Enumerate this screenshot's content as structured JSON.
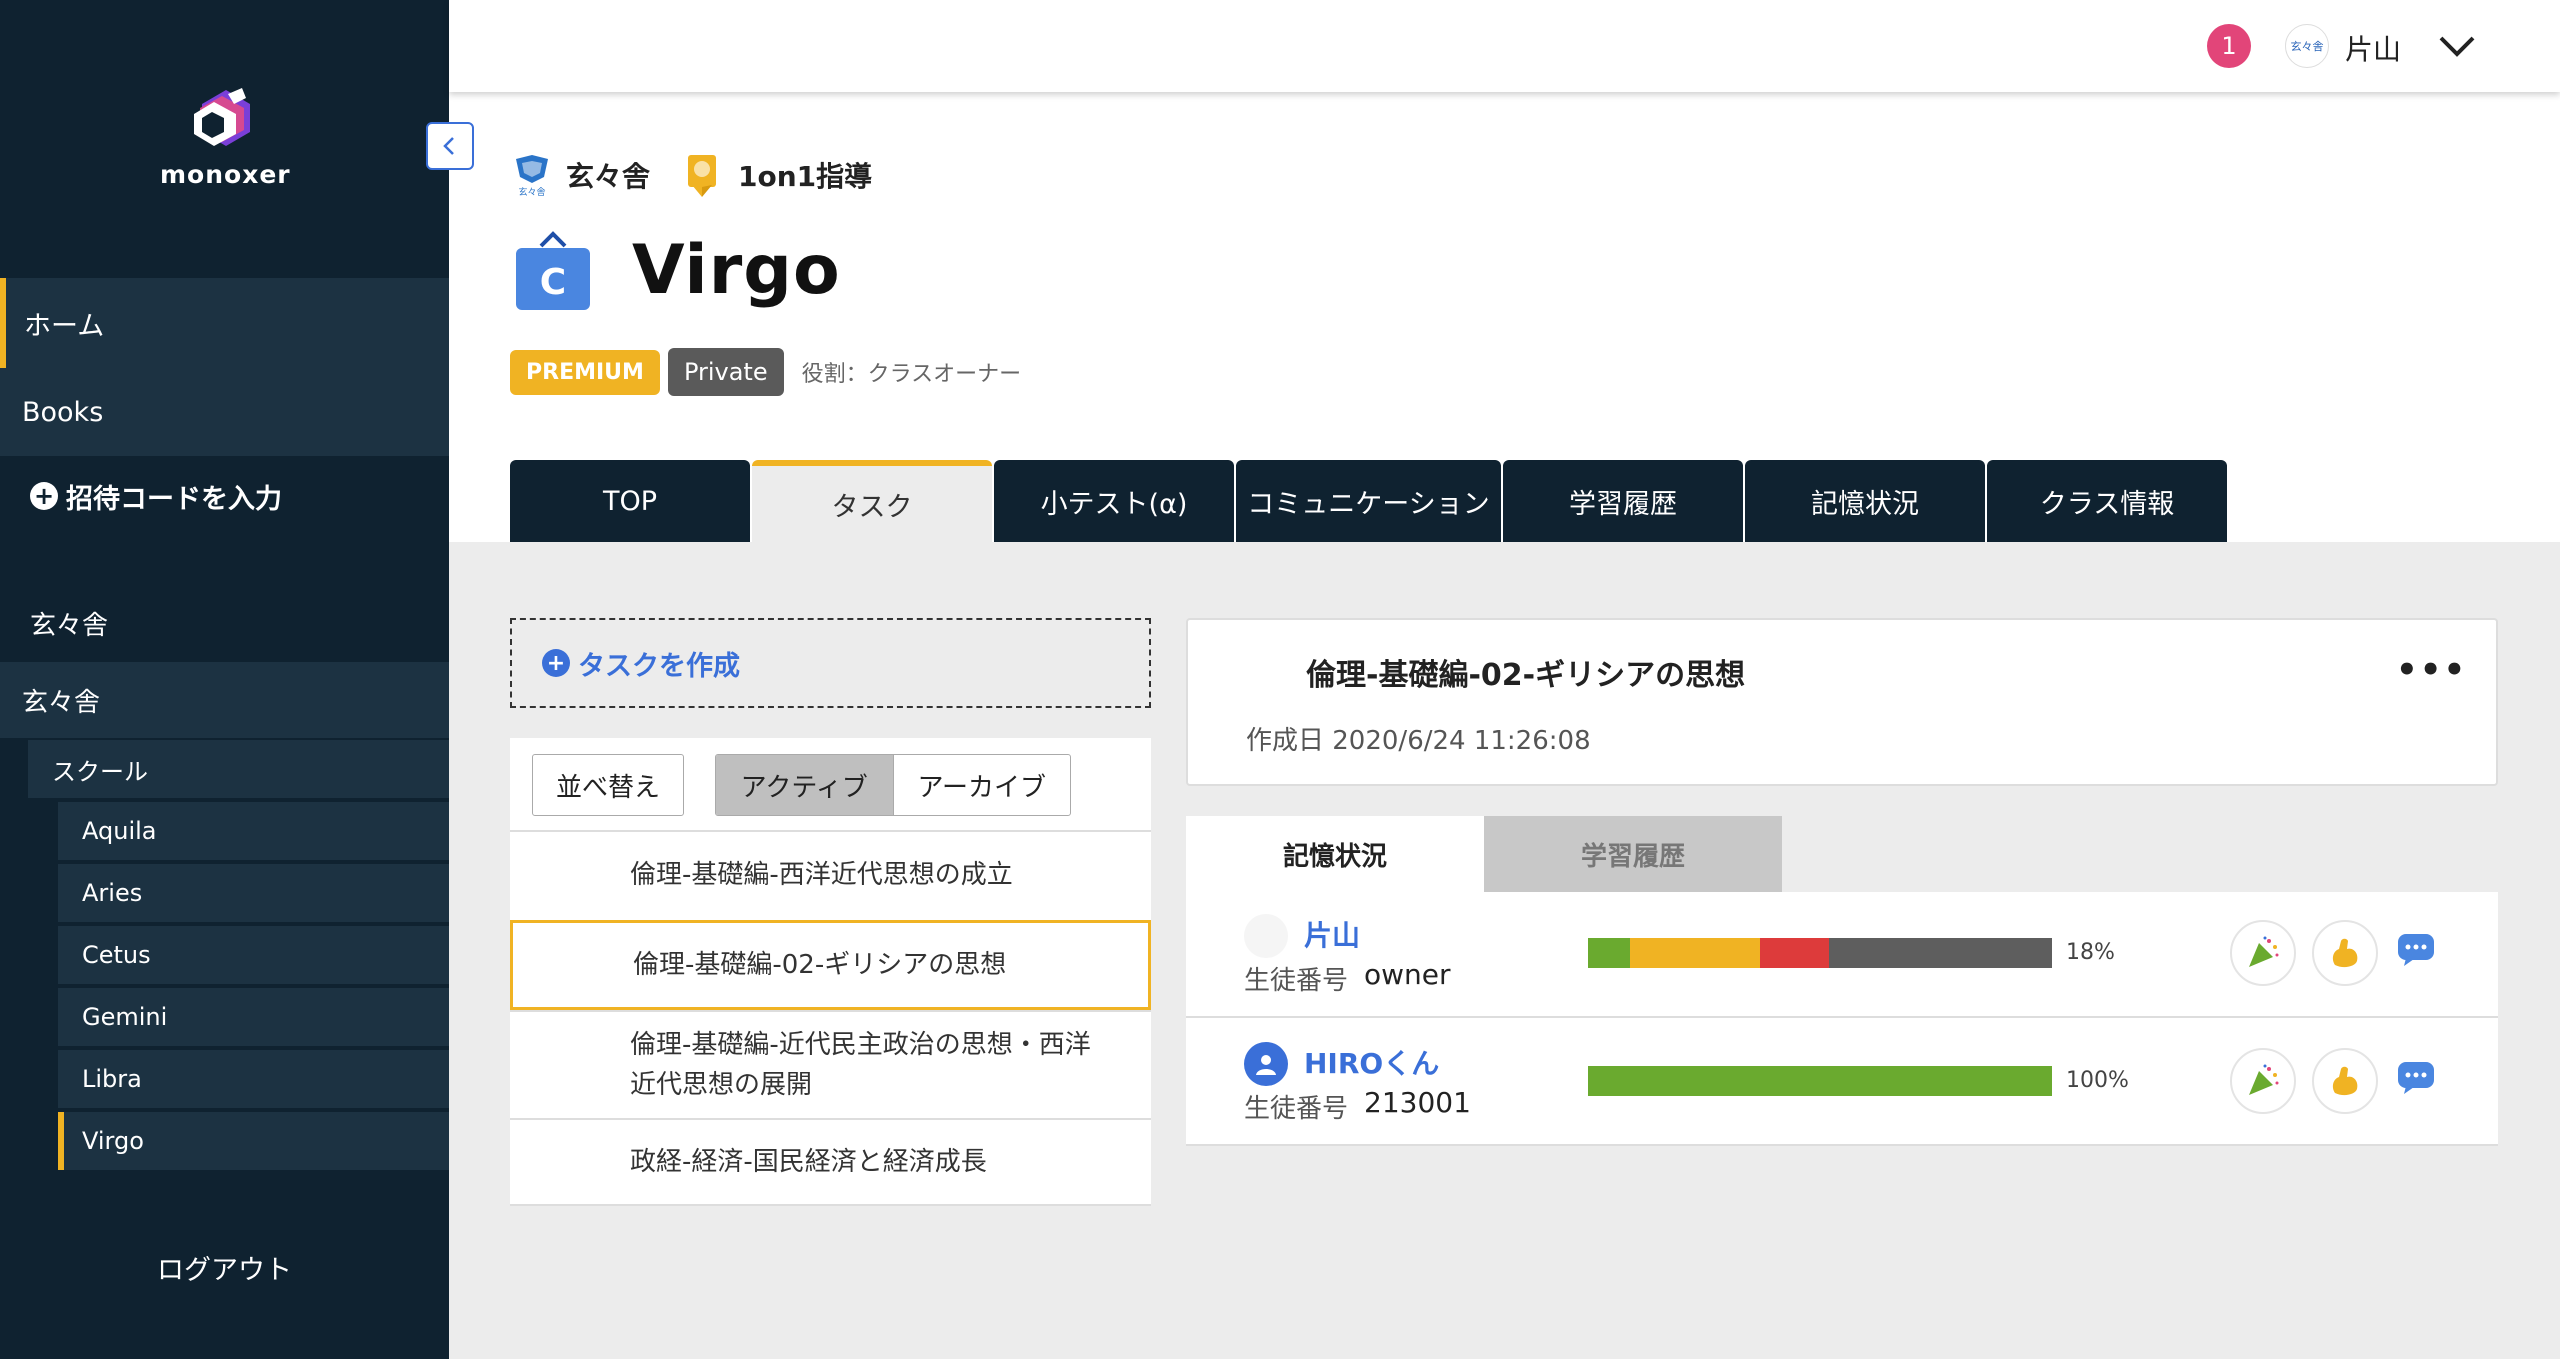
{
  "app": {
    "logo_text": "monoxer",
    "colors": {
      "sidebar": "#0f2230",
      "accent": "#f0b323",
      "link": "#3a6fd8",
      "badge": "#e24579"
    }
  },
  "sidebar": {
    "home": "ホーム",
    "books": "Books",
    "invite": "招待コードを入力",
    "org_heading": "玄々舎",
    "org_item": "玄々舎",
    "school": "スクール",
    "classes": [
      "Aquila",
      "Aries",
      "Cetus",
      "Gemini",
      "Libra",
      "Virgo"
    ],
    "active_class": "Virgo",
    "logout": "ログアウト"
  },
  "header": {
    "notification_count": "1",
    "avatar_text": "玄々舎",
    "user_name": "片山",
    "icons": {
      "caret": "chevron-down-icon"
    }
  },
  "class": {
    "org_name": "玄々舎",
    "program": "1on1指導",
    "title": "Virgo",
    "badge_premium": "PREMIUM",
    "badge_private": "Private",
    "role": "役割：クラスオーナー"
  },
  "tabs": [
    {
      "label": "TOP",
      "active": false
    },
    {
      "label": "タスク",
      "active": true
    },
    {
      "label": "小テスト(α)",
      "active": false
    },
    {
      "label": "コミュニケーション",
      "active": false
    },
    {
      "label": "学習履歴",
      "active": false
    },
    {
      "label": "記憶状況",
      "active": false
    },
    {
      "label": "クラス情報",
      "active": false
    }
  ],
  "tasks": {
    "create_label": "タスクを作成",
    "sort_label": "並べ替え",
    "filter_active": "アクティブ",
    "filter_archive": "アーカイブ",
    "items": [
      {
        "line1": "倫理-基礎編-西洋近代思想の成立",
        "line2": ""
      },
      {
        "line1": "倫理-基礎編-02-ギリシアの思想",
        "line2": ""
      },
      {
        "line1": "倫理-基礎編-近代民主政治の思想・西洋",
        "line2": "近代思想の展開"
      },
      {
        "line1": "政経-経済-国民経済と経済成長",
        "line2": ""
      }
    ],
    "selected_index": 1
  },
  "detail": {
    "title": "倫理-基礎編-02-ギリシアの思想",
    "created": "作成日 2020/6/24 11:26:08",
    "more": "•••",
    "sub_tabs": [
      "記憶状況",
      "学習履歴"
    ],
    "members": [
      {
        "name": "片山",
        "id_label": "生徒番号",
        "id": "owner",
        "percent": "18%",
        "segments": [
          {
            "color": "#6aaa2f",
            "fraction": 0.09
          },
          {
            "color": "#f0b323",
            "fraction": 0.28
          },
          {
            "color": "#dd3b3b",
            "fraction": 0.15
          },
          {
            "color": "#5e5e5e",
            "fraction": 0.48
          }
        ]
      },
      {
        "name": "HIROくん",
        "id_label": "生徒番号",
        "id": "213001",
        "percent": "100%",
        "segments": [
          {
            "color": "#6aaa2f",
            "fraction": 1.0
          }
        ]
      }
    ]
  }
}
